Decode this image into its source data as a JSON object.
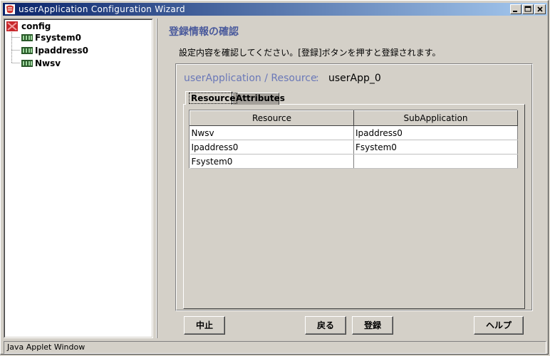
{
  "window": {
    "title": "userApplication Configuration Wizard"
  },
  "tree": {
    "root": "config",
    "children": [
      "Fsystem0",
      "Ipaddress0",
      "Nwsv"
    ]
  },
  "main": {
    "heading": "登録情報の確認",
    "instruction": "設定内容を確認してください。[登録]ボタンを押すと登録されます。",
    "resource_path": "userApplication / Resource",
    "separator": ":",
    "app_name": "userApp_0",
    "tabs": [
      {
        "label": "Resource",
        "active": true
      },
      {
        "label": "Attributes",
        "active": false
      }
    ],
    "table": {
      "columns": [
        "Resource",
        "SubApplication"
      ],
      "rows": [
        [
          "Nwsv",
          "Ipaddress0"
        ],
        [
          "Ipaddress0",
          "Fsystem0"
        ],
        [
          "Fsystem0",
          ""
        ]
      ]
    }
  },
  "buttons": {
    "abort": "中止",
    "back": "戻る",
    "register": "登録",
    "help": "ヘルプ"
  },
  "status": {
    "text": "Java Applet Window"
  },
  "colors": {
    "titlebar_start": "#0a246a",
    "titlebar_end": "#a6caf0",
    "heading": "#4a5a9c",
    "window_bg": "#d4d0c8"
  }
}
